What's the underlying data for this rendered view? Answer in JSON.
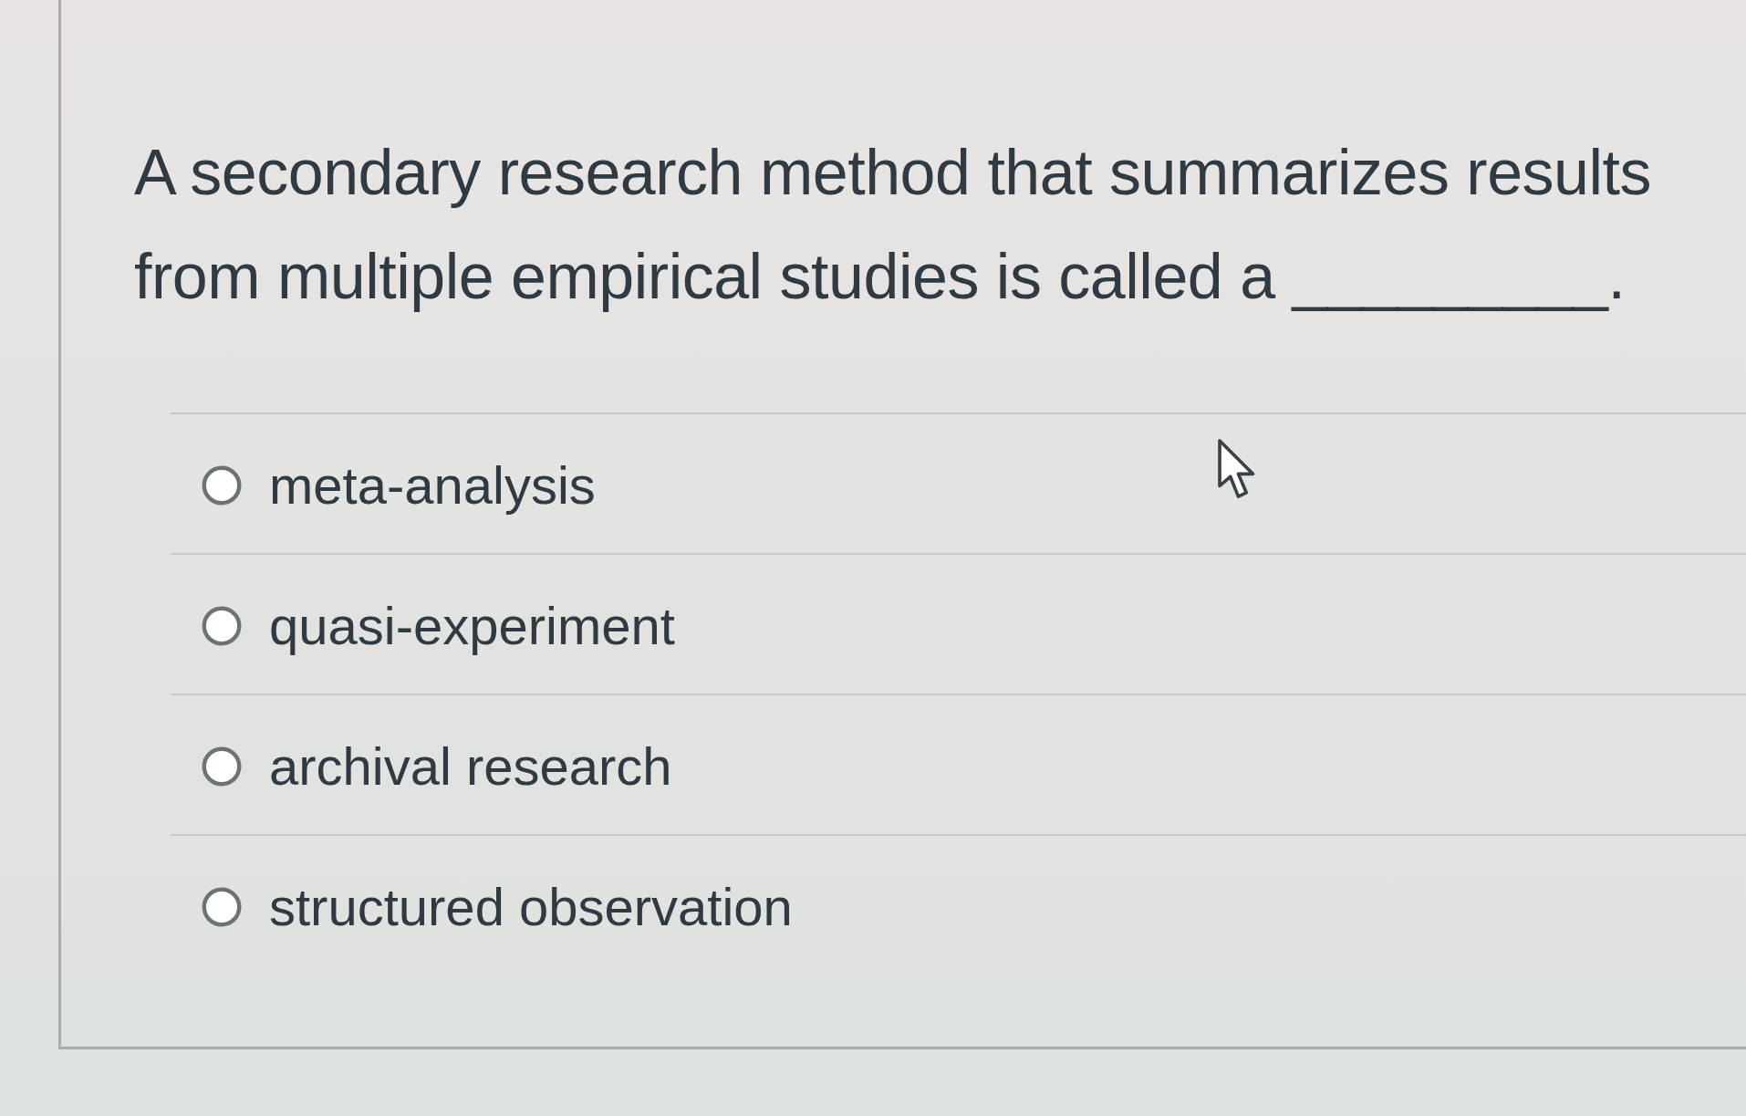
{
  "question": {
    "text": "A secondary research method that summarizes results from multiple empirical studies is called a _________."
  },
  "answers": [
    {
      "label": "meta-analysis",
      "selected": false
    },
    {
      "label": "quasi-experiment",
      "selected": false
    },
    {
      "label": "archival research",
      "selected": false
    },
    {
      "label": "structured observation",
      "selected": false
    }
  ]
}
